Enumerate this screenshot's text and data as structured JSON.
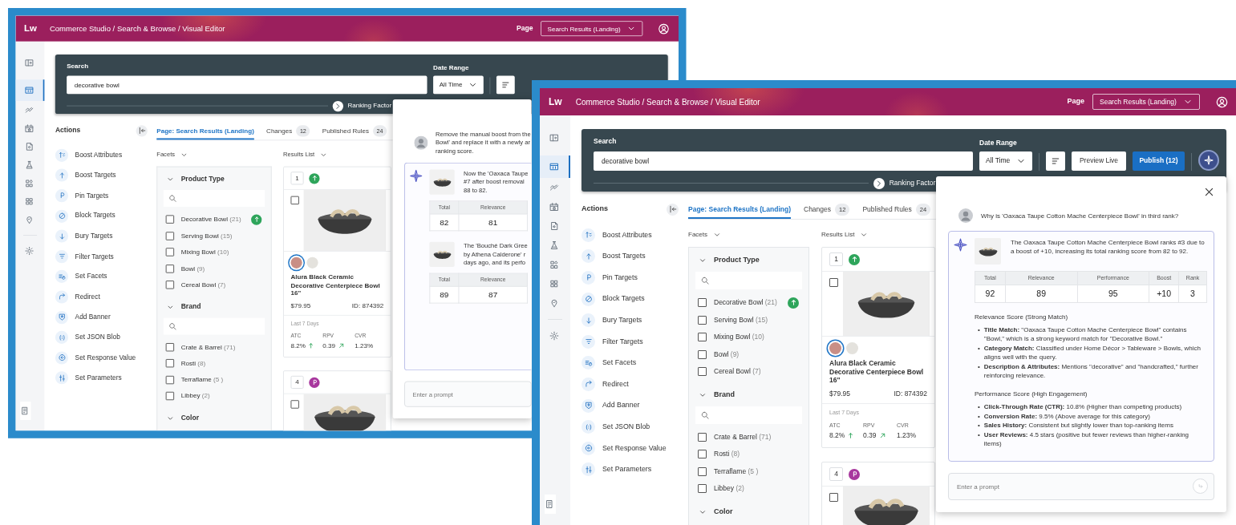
{
  "windows": [
    {
      "app_bar": {
        "logo": "Lw",
        "breadcrumb": "Commerce Studio / Search & Browse / Visual Editor",
        "page_label": "Page",
        "page_value": "Search Results (Landing)"
      },
      "sidebar": {
        "items": [
          {
            "kind": "panel",
            "selected": false
          },
          {
            "kind": "layout",
            "selected": true
          },
          {
            "kind": "trend",
            "selected": false
          },
          {
            "kind": "calendar",
            "selected": false
          },
          {
            "kind": "document",
            "selected": false
          },
          {
            "kind": "flask",
            "selected": false
          },
          {
            "kind": "blocks",
            "selected": false
          },
          {
            "kind": "grid",
            "selected": false
          },
          {
            "kind": "location",
            "selected": false
          }
        ],
        "settings_items": [
          {
            "kind": "settings",
            "selected": false
          }
        ],
        "bottom_items": [
          {
            "kind": "notes",
            "selected": false
          }
        ]
      },
      "search": {
        "label": "Search",
        "value": "decorative bowl",
        "date_label": "Date Range",
        "date_value": "All Time",
        "assistant_button": false,
        "ranking_label": "Ranking Factor"
      },
      "actions": {
        "title": "Actions",
        "items": [
          {
            "kind": "boost_attributes",
            "label": "Boost Attributes"
          },
          {
            "kind": "boost",
            "label": "Boost Targets"
          },
          {
            "kind": "pin",
            "label": "Pin Targets"
          },
          {
            "kind": "block",
            "label": "Block Targets"
          },
          {
            "kind": "bury",
            "label": "Bury Targets"
          },
          {
            "kind": "filter",
            "label": "Filter Targets"
          },
          {
            "kind": "facets",
            "label": "Set Facets"
          },
          {
            "kind": "redirect",
            "label": "Redirect"
          },
          {
            "kind": "banner",
            "label": "Add Banner"
          },
          {
            "kind": "json",
            "label": "Set JSON Blob"
          },
          {
            "kind": "response",
            "label": "Set Response Value"
          },
          {
            "kind": "parameters",
            "label": "Set Parameters"
          }
        ]
      },
      "tabs": [
        {
          "label": "Page: Search Results (Landing)",
          "selected": true
        },
        {
          "label": "Changes",
          "count": "12",
          "selected": false
        },
        {
          "label": "Published Rules",
          "count": "24",
          "selected": false
        }
      ],
      "facets": {
        "label": "Facets",
        "groups": [
          {
            "title": "Product Type",
            "expanded": true,
            "search_field": true,
            "options": [
              {
                "label": "Decorative Bowl",
                "count": "(21)",
                "checked": false,
                "boosted": true
              },
              {
                "label": "Serving Bowl",
                "count": "(15)",
                "checked": false,
                "boosted": false
              },
              {
                "label": "Mixing Bowl",
                "count": "(10)",
                "checked": false,
                "boosted": false
              },
              {
                "label": "Bowl",
                "count": "(9)",
                "checked": false,
                "boosted": false
              },
              {
                "label": "Cereal Bowl",
                "count": "(7)",
                "checked": false,
                "boosted": false
              }
            ]
          },
          {
            "title": "Brand",
            "expanded": true,
            "search_field": true,
            "options": [
              {
                "label": "Crate & Barrel",
                "count": "(71)",
                "checked": false,
                "boosted": false
              },
              {
                "label": "Rosti",
                "count": "(8)",
                "checked": false,
                "boosted": false
              },
              {
                "label": "Terraflame ",
                "count": "(5 )",
                "checked": false,
                "boosted": false
              },
              {
                "label": "Libbey",
                "count": "(2)",
                "checked": false,
                "boosted": false
              }
            ]
          },
          {
            "title": "Color",
            "expanded": true,
            "search_field": false
          }
        ]
      },
      "results": {
        "label": "Results List",
        "cards": [
          {
            "rank": "1",
            "badge": {
              "kind": "boost"
            },
            "checked": false,
            "swatches": [
              {
                "color": "#c98f86",
                "selected": true
              },
              {
                "color": "#e4e2dd",
                "selected": false
              }
            ],
            "title": "Alura Black Ceramic Decorative Centerpiece Bowl 16\"",
            "price": "$79.95",
            "product_id": "ID: 874392",
            "period": "Last 7 Days",
            "metrics": [
              {
                "label": "ATC",
                "value": "8.2%",
                "trend": {
                  "kind": "up"
                }
              },
              {
                "label": "RPV",
                "value": "0.39",
                "trend": {
                  "kind": "rising"
                }
              },
              {
                "label": "CVR",
                "value": "1.23%"
              }
            ]
          },
          {
            "rank": "4",
            "badge": {
              "kind": "pin"
            },
            "checked": false
          }
        ]
      },
      "chat": {
        "closable": false,
        "message": {
          "lines": [
            "Remove the manual boost from the",
            "Bowl' and replace it with a newly ar",
            "ranking score."
          ]
        },
        "entries": [
          {
            "lines": [
              "Now the 'Oaxaca Taupe",
              "#7 after boost removal",
              "88 to 82."
            ],
            "table": {
              "headers": [
                "Total",
                "Relevance"
              ],
              "values": [
                "82",
                "81"
              ]
            }
          },
          {
            "lines": [
              "The 'Bouché Dark Gree",
              "by Athena Calderone' r",
              "days ago, and its perfo"
            ],
            "table": {
              "headers": [
                "Total",
                "Relevance"
              ],
              "values": [
                "89",
                "87"
              ]
            }
          }
        ],
        "prompt": {
          "placeholder": "Enter a prompt",
          "send_button": false
        }
      }
    },
    {
      "app_bar": {
        "logo": "Lw",
        "breadcrumb": "Commerce Studio / Search & Browse / Visual Editor",
        "page_label": "Page",
        "page_value": "Search Results (Landing)"
      },
      "sidebar": {
        "items": [
          {
            "kind": "panel",
            "selected": false
          },
          {
            "kind": "layout",
            "selected": true
          },
          {
            "kind": "trend",
            "selected": false
          },
          {
            "kind": "calendar",
            "selected": false
          },
          {
            "kind": "document",
            "selected": false
          },
          {
            "kind": "flask",
            "selected": false
          },
          {
            "kind": "blocks",
            "selected": false
          },
          {
            "kind": "grid",
            "selected": false
          },
          {
            "kind": "location",
            "selected": false
          }
        ],
        "settings_items": [
          {
            "kind": "settings",
            "selected": false
          }
        ],
        "bottom_items": [
          {
            "kind": "notes",
            "selected": false
          }
        ]
      },
      "search": {
        "label": "Search",
        "value": "decorative bowl",
        "date_label": "Date Range",
        "date_value": "All Time",
        "preview_label": "Preview Live",
        "publish_label": "Publish (12)",
        "assistant_button": true,
        "ranking_label": "Ranking Factor"
      },
      "actions": {
        "title": "Actions",
        "items": [
          {
            "kind": "boost_attributes",
            "label": "Boost Attributes"
          },
          {
            "kind": "boost",
            "label": "Boost Targets"
          },
          {
            "kind": "pin",
            "label": "Pin Targets"
          },
          {
            "kind": "block",
            "label": "Block Targets"
          },
          {
            "kind": "bury",
            "label": "Bury Targets"
          },
          {
            "kind": "filter",
            "label": "Filter Targets"
          },
          {
            "kind": "facets",
            "label": "Set Facets"
          },
          {
            "kind": "redirect",
            "label": "Redirect"
          },
          {
            "kind": "banner",
            "label": "Add Banner"
          },
          {
            "kind": "json",
            "label": "Set JSON Blob"
          },
          {
            "kind": "response",
            "label": "Set Response Value"
          },
          {
            "kind": "parameters",
            "label": "Set Parameters"
          }
        ]
      },
      "tabs": [
        {
          "label": "Page: Search Results (Landing)",
          "selected": true
        },
        {
          "label": "Changes",
          "count": "12",
          "selected": false
        },
        {
          "label": "Published Rules",
          "count": "24",
          "selected": false
        }
      ],
      "facets": {
        "label": "Facets",
        "groups": [
          {
            "title": "Product Type",
            "expanded": true,
            "search_field": true,
            "options": [
              {
                "label": "Decorative Bowl",
                "count": "(21)",
                "checked": false,
                "boosted": true
              },
              {
                "label": "Serving Bowl",
                "count": "(15)",
                "checked": false,
                "boosted": false
              },
              {
                "label": "Mixing Bowl",
                "count": "(10)",
                "checked": false,
                "boosted": false
              },
              {
                "label": "Bowl",
                "count": "(9)",
                "checked": false,
                "boosted": false
              },
              {
                "label": "Cereal Bowl",
                "count": "(7)",
                "checked": false,
                "boosted": false
              }
            ]
          },
          {
            "title": "Brand",
            "expanded": true,
            "search_field": true,
            "options": [
              {
                "label": "Crate & Barrel",
                "count": "(71)",
                "checked": false,
                "boosted": false
              },
              {
                "label": "Rosti",
                "count": "(8)",
                "checked": false,
                "boosted": false
              },
              {
                "label": "Terraflame ",
                "count": "(5 )",
                "checked": false,
                "boosted": false
              },
              {
                "label": "Libbey",
                "count": "(2)",
                "checked": false,
                "boosted": false
              }
            ]
          },
          {
            "title": "Color",
            "expanded": true,
            "search_field": false
          }
        ]
      },
      "results": {
        "label": "Results List",
        "cards": [
          {
            "rank": "1",
            "badge": {
              "kind": "boost"
            },
            "checked": false,
            "swatches": [
              {
                "color": "#c98f86",
                "selected": true
              },
              {
                "color": "#e4e2dd",
                "selected": false
              }
            ],
            "title": "Alura Black Ceramic Decorative Centerpiece Bowl 16\"",
            "price": "$79.95",
            "product_id": "ID: 874392",
            "period": "Last 7 Days",
            "metrics": [
              {
                "label": "ATC",
                "value": "8.2%",
                "trend": {
                  "kind": "up"
                }
              },
              {
                "label": "RPV",
                "value": "0.39",
                "trend": {
                  "kind": "rising"
                }
              },
              {
                "label": "CVR",
                "value": "1.23%"
              }
            ]
          },
          {
            "rank": "4",
            "badge": {
              "kind": "pin"
            },
            "checked": false
          }
        ]
      },
      "chat": {
        "closable": true,
        "message": {
          "text": "Why is 'Oaxaca Taupe Cotton Mache Centerpiece Bowl' in third rank?"
        },
        "entries": [
          {
            "text": "The Oaxaca Taupe Cotton Mache Centerpiece Bowl ranks #3 due to a boost of +10, increasing its total ranking score from 82 to 92.",
            "table": {
              "headers": [
                "Total",
                "Relevance",
                "Performance",
                "Boost",
                "Rank"
              ],
              "values": [
                "92",
                "89",
                "95",
                "+10",
                "3"
              ]
            }
          }
        ],
        "sections": [
          {
            "title": "**Relevance Score** (Strong Match)",
            "bullets": [
              {
                "marker": "•",
                "text": "**Title Match:** \"Oaxaca Taupe Cotton Mache Centerpiece Bowl\" contains \"Bowl,\" which is a strong keyword match for \"Decorative Bowl.\""
              },
              {
                "marker": "•",
                "text": "**Category Match:** Classified under Home Décor > Tableware > Bowls, which aligns well with the query."
              },
              {
                "marker": "•",
                "text": "**Description & Attributes:** Mentions \"decorative\" and \"handcrafted,\" further reinforcing relevance."
              }
            ]
          },
          {
            "title": "**Performance Score** (High Engagement)",
            "bullets": [
              {
                "marker": "•",
                "text": "**Click-Through Rate (CTR):** 10.8% (Higher than competing products)"
              },
              {
                "marker": "•",
                "text": "**Conversion Rate:** 9.5% (Above average for this category)"
              },
              {
                "marker": "•",
                "text": "**Sales History:** Consistent but slightly lower than top-ranking items"
              },
              {
                "marker": "•",
                "text": "**User Reviews:** 4.5 stars (positive but fewer reviews than higher-ranking items)"
              }
            ]
          }
        ],
        "prompt": {
          "placeholder": "Enter a prompt",
          "send_button": true
        }
      }
    }
  ]
}
